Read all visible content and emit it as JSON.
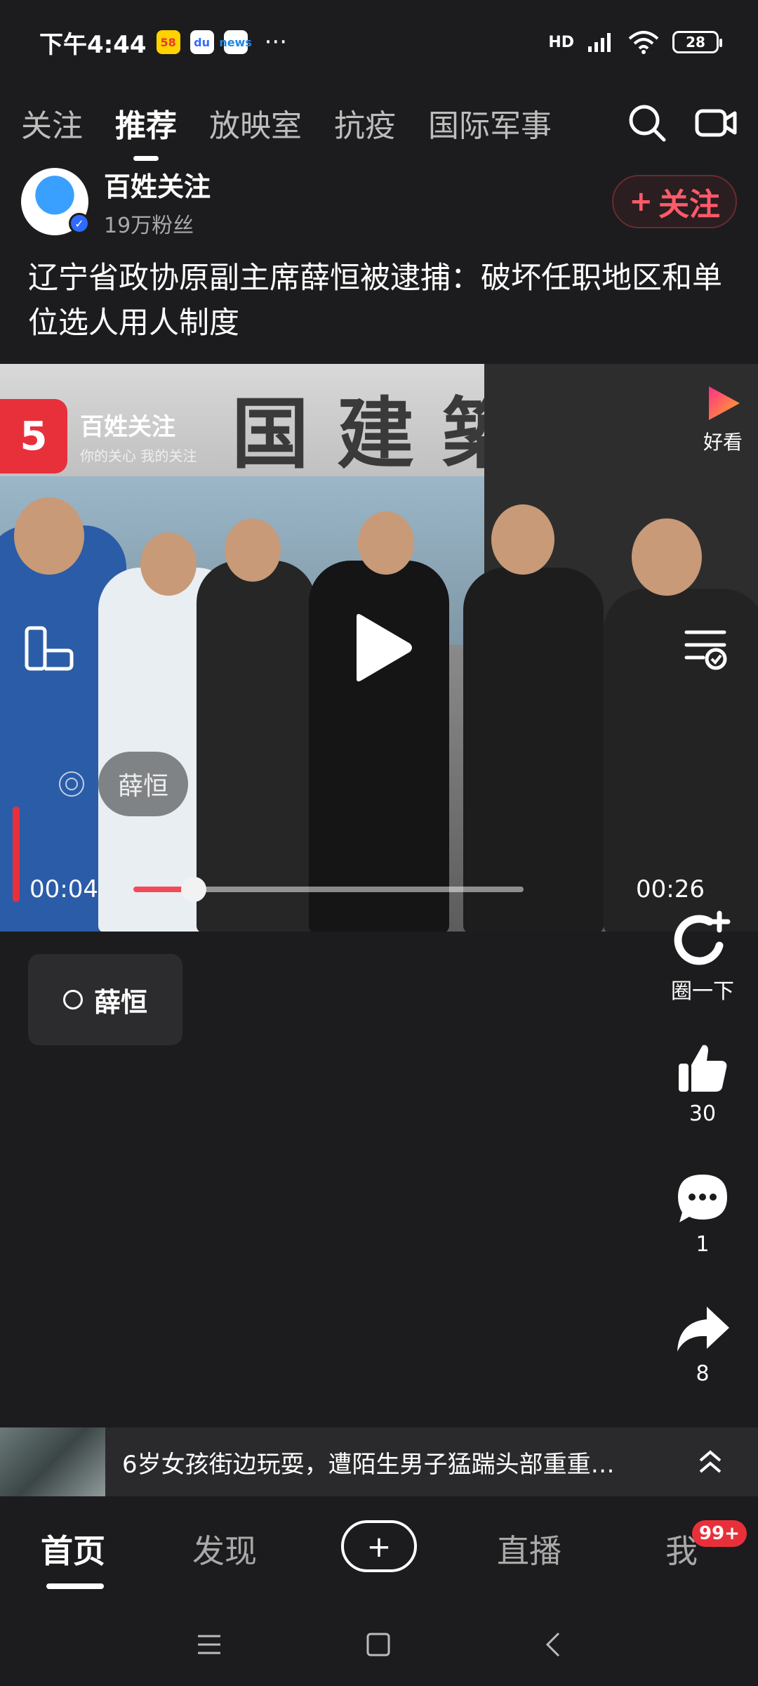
{
  "status_bar": {
    "time": "下午4:44",
    "apps": [
      "58",
      "du",
      "news"
    ],
    "more": "···",
    "signal": "HD",
    "battery": "28"
  },
  "tabs": [
    "关注",
    "推荐",
    "放映室",
    "抗疫",
    "国际军事"
  ],
  "active_tab": "推荐",
  "header_icons": [
    "search-icon",
    "video-camera-icon"
  ],
  "author": {
    "name": "百姓关注",
    "fans": "19万粉丝",
    "follow_label": "关注",
    "follow_plus": "+"
  },
  "article": {
    "title": "辽宁省政协原副主席薛恒被逮捕：破坏任职地区和单位选人用人制度"
  },
  "video": {
    "watermark_name": "百姓关注",
    "watermark_slogan": "你的关心 我的关注",
    "watermark_logo": "5",
    "sign_text": "国建築",
    "platform_label": "好看",
    "person_tag": "薛恒",
    "current_time": "00:04",
    "total_time": "00:26",
    "progress_fraction": 0.154
  },
  "topic_tag": {
    "label": "薛恒"
  },
  "actions": {
    "circle": {
      "label": "圈一下"
    },
    "like": {
      "count": "30"
    },
    "comment": {
      "count": "1"
    },
    "share": {
      "count": "8"
    }
  },
  "recommendation": {
    "text": "6岁女孩街边玩耍，遭陌生男子猛踹头部重重…"
  },
  "bottom_nav": {
    "home": "首页",
    "discover": "发现",
    "add": "+",
    "live": "直播",
    "me": "我",
    "me_badge": "99+"
  },
  "colors": {
    "background": "#1c1c1e",
    "accent_red": "#e8303b",
    "follow_red": "#ff5a6a"
  }
}
